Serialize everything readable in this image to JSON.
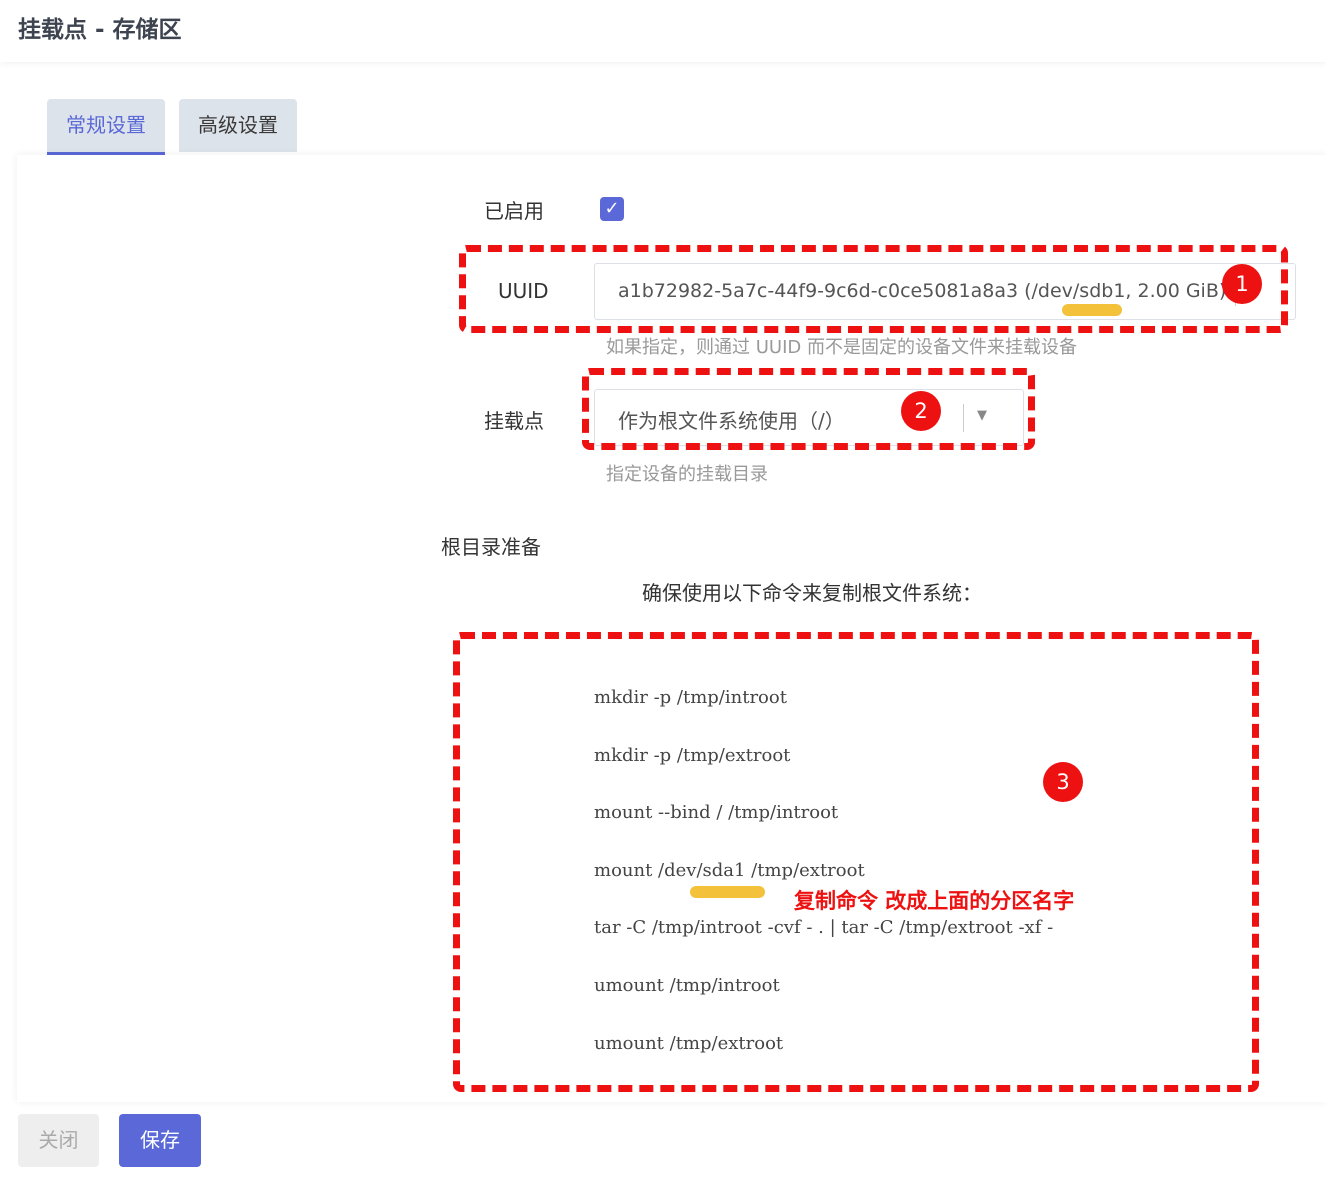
{
  "header": {
    "title": "挂载点 - 存储区"
  },
  "tabs": [
    {
      "label": "常规设置",
      "active": true
    },
    {
      "label": "高级设置",
      "active": false
    }
  ],
  "form": {
    "enabled": {
      "label": "已启用",
      "checked": true,
      "check_glyph": "✓"
    },
    "uuid": {
      "label": "UUID",
      "value": "a1b72982-5a7c-44f9-9c6d-c0ce5081a8a3 (/dev/sdb1, 2.00 GiB)",
      "hint": "如果指定，则通过 UUID 而不是固定的设备文件来挂载设备"
    },
    "mountpoint": {
      "label": "挂载点",
      "value": "作为根文件系统使用（/）",
      "hint": "指定设备的挂载目录",
      "arrow": "▼"
    },
    "rootprep": {
      "label": "根目录准备",
      "description": "确保使用以下命令来复制根文件系统：",
      "commands": [
        "mkdir -p /tmp/introot",
        "mkdir -p /tmp/extroot",
        "mount --bind / /tmp/introot",
        "mount /dev/sda1 /tmp/extroot",
        "tar -C /tmp/introot -cvf - . | tar -C /tmp/extroot -xf -",
        "umount /tmp/introot",
        "umount /tmp/extroot"
      ]
    }
  },
  "annotations": {
    "badges": [
      "1",
      "2",
      "3"
    ],
    "note": "复制命令 改成上面的分区名字",
    "highlight_color": "#ee1111",
    "marker_color": "#f3c13a"
  },
  "footer": {
    "close_label": "关闭",
    "save_label": "保存"
  },
  "colors": {
    "accent": "#5a68d8",
    "tab_bg": "#dde3ea"
  }
}
